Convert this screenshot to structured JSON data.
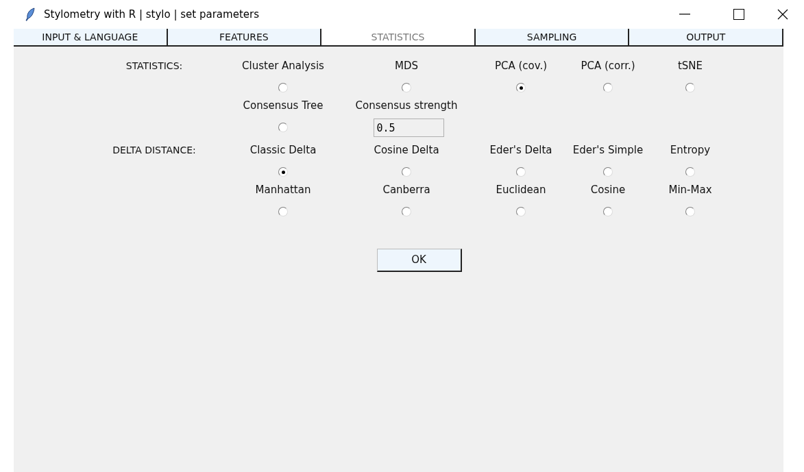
{
  "window": {
    "title": "Stylometry with R | stylo | set parameters"
  },
  "tabs": [
    {
      "label": "INPUT & LANGUAGE",
      "selected": false
    },
    {
      "label": "FEATURES",
      "selected": false
    },
    {
      "label": "STATISTICS",
      "selected": true
    },
    {
      "label": "SAMPLING",
      "selected": false
    },
    {
      "label": "OUTPUT",
      "selected": false
    }
  ],
  "rows": [
    {
      "label": "STATISTICS:",
      "options": [
        {
          "kind": "radio",
          "label": "Cluster Analysis",
          "selected": false
        },
        {
          "kind": "radio",
          "label": "MDS",
          "selected": false
        },
        {
          "kind": "radio",
          "label": "PCA (cov.)",
          "selected": true
        },
        {
          "kind": "radio",
          "label": "PCA (corr.)",
          "selected": false
        },
        {
          "kind": "radio",
          "label": "tSNE",
          "selected": false
        }
      ]
    },
    {
      "options": [
        {
          "kind": "radio",
          "label": "Consensus Tree",
          "selected": false
        },
        {
          "kind": "field",
          "label": "Consensus strength",
          "value": "0.5"
        }
      ]
    },
    {
      "label": "DELTA DISTANCE:",
      "options": [
        {
          "kind": "radio",
          "label": "Classic Delta",
          "selected": true
        },
        {
          "kind": "radio",
          "label": "Cosine Delta",
          "selected": false
        },
        {
          "kind": "radio",
          "label": "Eder's Delta",
          "selected": false
        },
        {
          "kind": "radio",
          "label": "Eder's Simple",
          "selected": false
        },
        {
          "kind": "radio",
          "label": "Entropy",
          "selected": false
        }
      ]
    },
    {
      "options": [
        {
          "kind": "radio",
          "label": "Manhattan",
          "selected": false
        },
        {
          "kind": "radio",
          "label": "Canberra",
          "selected": false
        },
        {
          "kind": "radio",
          "label": "Euclidean",
          "selected": false
        },
        {
          "kind": "radio",
          "label": "Cosine",
          "selected": false
        },
        {
          "kind": "radio",
          "label": "Min-Max",
          "selected": false
        }
      ]
    }
  ],
  "ok_button": "OK"
}
